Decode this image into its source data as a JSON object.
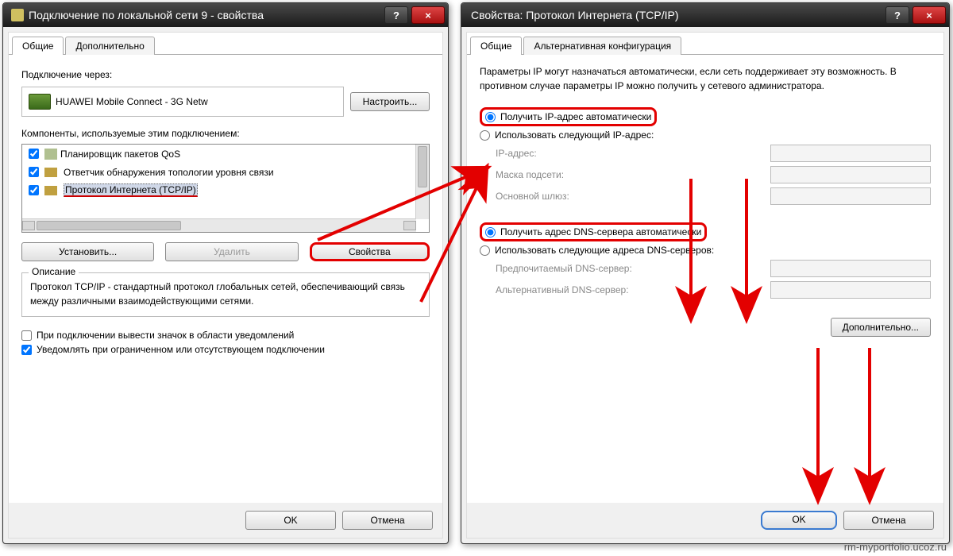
{
  "left": {
    "title": "Подключение по локальной сети 9 - свойства",
    "tabs": {
      "general": "Общие",
      "advanced": "Дополнительно"
    },
    "connect_via_label": "Подключение через:",
    "adapter": "HUAWEI Mobile Connect - 3G Netw",
    "configure_btn": "Настроить...",
    "components_label": "Компоненты, используемые этим подключением:",
    "items": [
      "Планировщик пакетов QoS",
      "Ответчик обнаружения топологии уровня связи",
      "Протокол Интернета (TCP/IP)"
    ],
    "install_btn": "Установить...",
    "remove_btn": "Удалить",
    "properties_btn": "Свойства",
    "desc_legend": "Описание",
    "desc_text": "Протокол TCP/IP - стандартный протокол глобальных сетей, обеспечивающий связь между различными взаимодействующими сетями.",
    "show_icon_label": "При подключении вывести значок в области уведомлений",
    "notify_label": "Уведомлять при ограниченном или отсутствующем подключении",
    "ok": "OK",
    "cancel": "Отмена"
  },
  "right": {
    "title": "Свойства: Протокол Интернета (TCP/IP)",
    "tabs": {
      "general": "Общие",
      "alt": "Альтернативная конфигурация"
    },
    "intro": "Параметры IP могут назначаться автоматически, если сеть поддерживает эту возможность. В противном случае параметры IP можно получить у сетевого администратора.",
    "ip_auto": "Получить IP-адрес автоматически",
    "ip_manual": "Использовать следующий IP-адрес:",
    "ip_label": "IP-адрес:",
    "mask_label": "Маска подсети:",
    "gw_label": "Основной шлюз:",
    "dns_auto": "Получить адрес DNS-сервера автоматически",
    "dns_manual": "Использовать следующие адреса DNS-серверов:",
    "dns_pref": "Предпочитаемый DNS-сервер:",
    "dns_alt": "Альтернативный DNS-сервер:",
    "advanced_btn": "Дополнительно...",
    "ok": "OK",
    "cancel": "Отмена"
  },
  "watermark": "rm-myportfolio.ucoz.ru"
}
